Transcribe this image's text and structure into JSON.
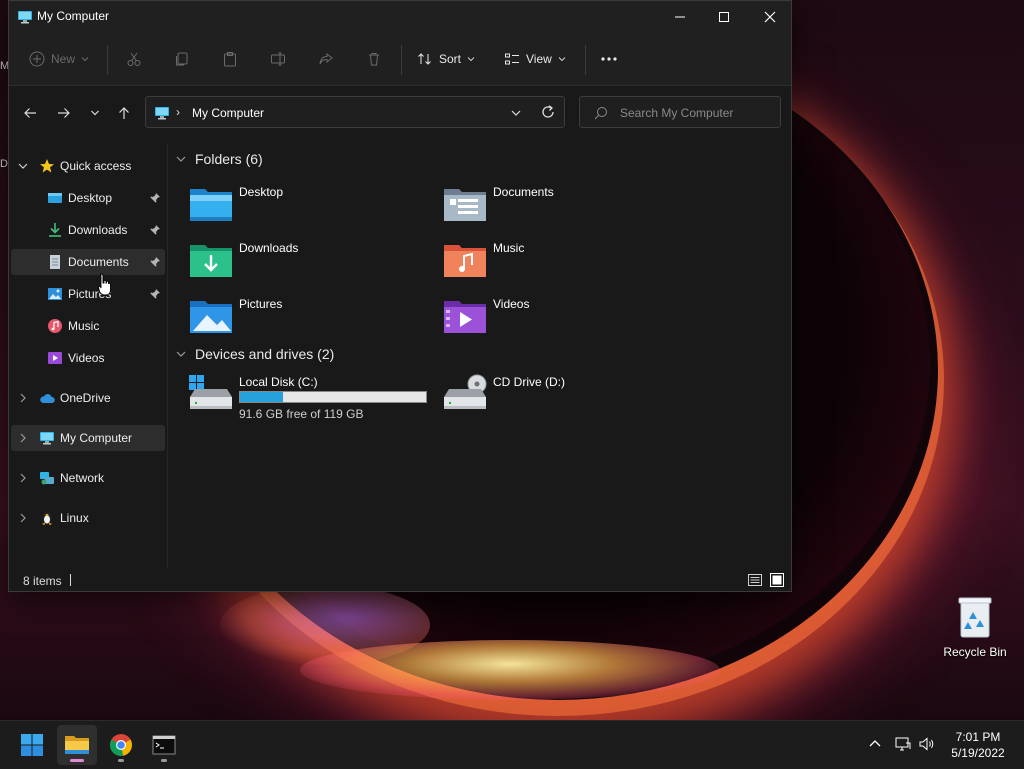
{
  "window": {
    "title": "My Computer",
    "controls": {
      "minimize": "minimize-icon",
      "maximize": "maximize-icon",
      "close": "close-icon"
    }
  },
  "toolbar": {
    "new_label": "New",
    "sort_label": "Sort",
    "view_label": "View",
    "icons": [
      "cut-icon",
      "copy-icon",
      "paste-icon",
      "rename-icon",
      "share-icon",
      "delete-icon",
      "more-icon"
    ]
  },
  "address": {
    "path": "My Computer",
    "search_placeholder": "Search My Computer"
  },
  "sidebar": {
    "quick_access": "Quick access",
    "items": [
      {
        "label": "Desktop",
        "pinned": true
      },
      {
        "label": "Downloads",
        "pinned": true
      },
      {
        "label": "Documents",
        "pinned": true
      },
      {
        "label": "Pictures",
        "pinned": true
      },
      {
        "label": "Music",
        "pinned": false
      },
      {
        "label": "Videos",
        "pinned": false
      }
    ],
    "roots": [
      {
        "label": "OneDrive"
      },
      {
        "label": "My Computer"
      },
      {
        "label": "Network"
      },
      {
        "label": "Linux"
      }
    ]
  },
  "content": {
    "folders_header": "Folders (6)",
    "folders": [
      {
        "label": "Desktop"
      },
      {
        "label": "Documents"
      },
      {
        "label": "Downloads"
      },
      {
        "label": "Music"
      },
      {
        "label": "Pictures"
      },
      {
        "label": "Videos"
      }
    ],
    "drives_header": "Devices and drives (2)",
    "drives": [
      {
        "label": "Local Disk (C:)",
        "free_text": "91.6 GB free of 119 GB",
        "used_fraction": 0.23
      },
      {
        "label": "CD Drive (D:)"
      }
    ]
  },
  "status": {
    "items_text": "8 items"
  },
  "desktop": {
    "recycle_bin": "Recycle Bin"
  },
  "taskbar": {
    "time": "7:01 PM",
    "date": "5/19/2022"
  },
  "colors": {
    "accent": "#26a0da",
    "window_bg": "#191919",
    "taskbar_bg": "#1c1c1c"
  }
}
